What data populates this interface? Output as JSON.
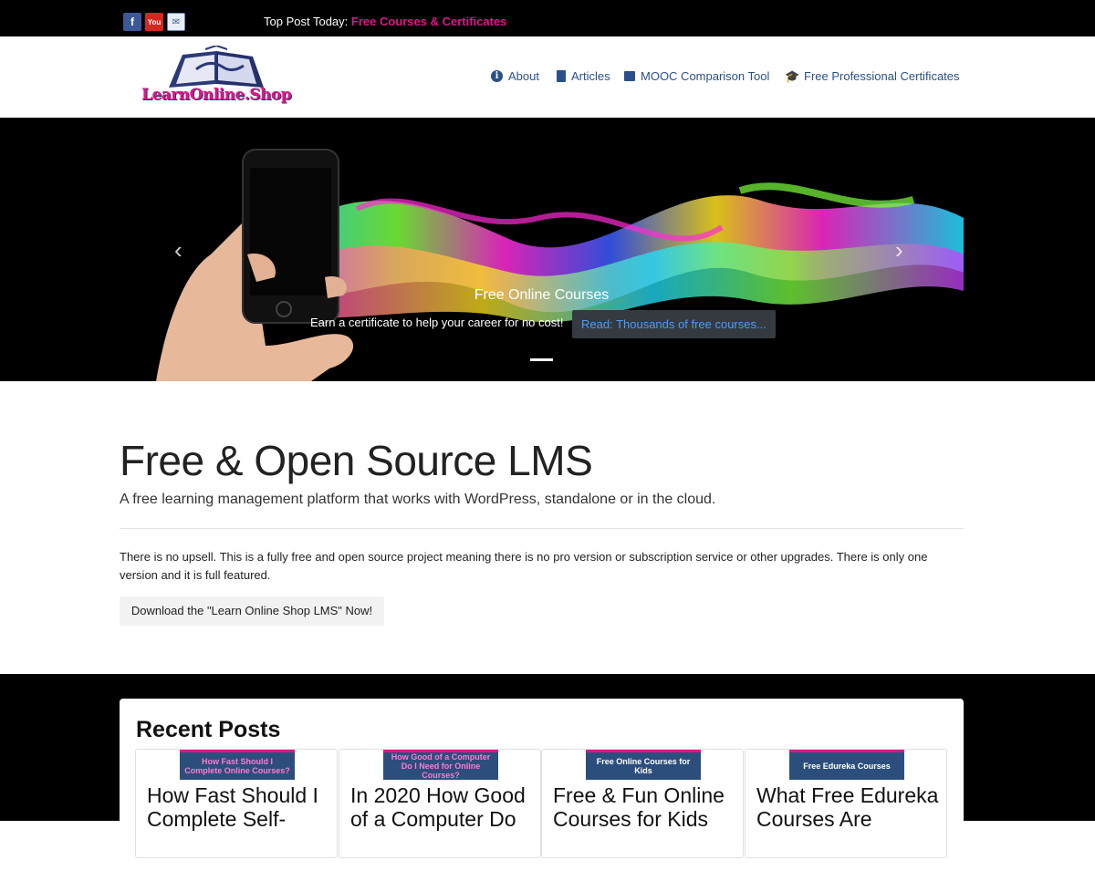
{
  "topbar": {
    "social": [
      {
        "name": "facebook",
        "glyph": "f"
      },
      {
        "name": "youtube",
        "glyph": "You"
      },
      {
        "name": "email",
        "glyph": "✉"
      }
    ],
    "top_post_label": "Top Post Today:",
    "top_post_link": "Free Courses & Certificates"
  },
  "header": {
    "logo_text": "LearnOnline.Shop",
    "nav": [
      {
        "icon": "info-icon",
        "label": "About"
      },
      {
        "icon": "document-icon",
        "label": "Articles"
      },
      {
        "icon": "newspaper-icon",
        "label": "MOOC Comparison Tool"
      },
      {
        "icon": "graduation-cap-icon",
        "label": "Free Professional Certificates"
      }
    ]
  },
  "hero": {
    "title": "Free Online Courses",
    "subtitle": "Earn a certificate to help your career for no cost!",
    "button": "Read: Thousands of free courses...",
    "prev": "‹",
    "next": "›"
  },
  "main": {
    "title": "Free & Open Source LMS",
    "subtitle": "A free learning management platform that works with WordPress, standalone or in the cloud.",
    "paragraph": "There is no upsell. This is a fully free and open source project meaning there is no pro version or subscription service or other upgrades. There is only one version and it is full featured.",
    "download_button": "Download the \"Learn Online Shop LMS\" Now!"
  },
  "recent": {
    "title": "Recent Posts",
    "posts": [
      {
        "thumb": "How Fast Should I Complete Online Courses?",
        "title": "How Fast Should I Complete Self-"
      },
      {
        "thumb": "How Good of a Computer Do I Need for Online Courses?",
        "title": "In 2020 How Good of a Computer Do"
      },
      {
        "thumb": "Free Online Courses for Kids",
        "title": "Free & Fun Online Courses for Kids"
      },
      {
        "thumb": "Free Edureka Courses",
        "title": "What Free Edureka Courses Are"
      }
    ]
  },
  "colors": {
    "accent_pink": "#e0158a",
    "nav_blue": "#2b4f8b",
    "hero_button_text": "#4a9cff"
  }
}
